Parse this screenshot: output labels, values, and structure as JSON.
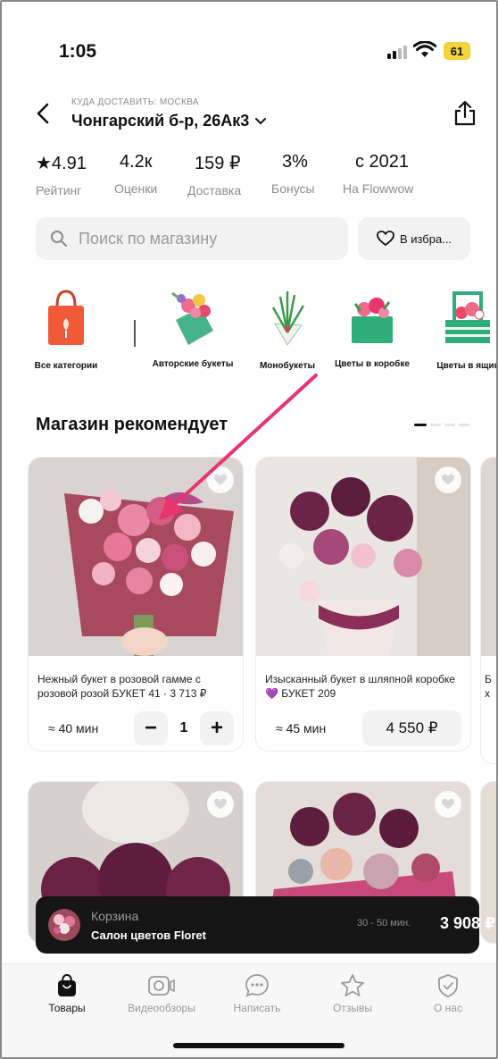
{
  "status_bar": {
    "time": "1:05",
    "battery": "61"
  },
  "header": {
    "delivery_caption": "КУДА ДОСТАВИТЬ: МОСКВА",
    "address": "Чонгарский б-р, 26Ак3"
  },
  "stats": [
    {
      "value": "★4.91",
      "label": "Рейтинг"
    },
    {
      "value": "4.2к",
      "label": "Оценки"
    },
    {
      "value": "159 ₽",
      "label": "Доставка"
    },
    {
      "value": "3%",
      "label": "Бонусы"
    },
    {
      "value": "с 2021",
      "label": "На Flowwow"
    }
  ],
  "search": {
    "placeholder": "Поиск по магазину"
  },
  "favorites": {
    "label": "В избра..."
  },
  "categories": [
    {
      "label": "Все категории"
    },
    {
      "label": "Авторские букеты"
    },
    {
      "label": "Монобукеты"
    },
    {
      "label": "Цветы в коробке"
    },
    {
      "label": "Цветы в ящик"
    }
  ],
  "section": {
    "title": "Магазин рекомендует"
  },
  "products": [
    {
      "title": "Нежный букет в розовой гамме с розовой розой БУКЕТ 41 · 3 713 ₽",
      "eta": "≈ 40 мин",
      "quantity": "1",
      "minus": "−",
      "plus": "+"
    },
    {
      "title": "Изысканный букет в шляпной коробке💜 БУКЕТ 209",
      "eta": "≈ 45 мин",
      "price": "4 550 ₽"
    }
  ],
  "peek_text": {
    "line1": "Б",
    "line2": "х"
  },
  "cart": {
    "label": "Корзина",
    "shop": "Салон цветов Floret",
    "time": "30 - 50 мин.",
    "price": "3 908 ₽"
  },
  "tabs": [
    {
      "label": "Товары",
      "icon": "bag-icon"
    },
    {
      "label": "Видеообзоры",
      "icon": "video-icon"
    },
    {
      "label": "Написать",
      "icon": "chat-icon"
    },
    {
      "label": "Отзывы",
      "icon": "star-icon"
    },
    {
      "label": "О нас",
      "icon": "shield-icon"
    }
  ],
  "colors": {
    "accent": "#e8356d",
    "battery": "#f5d33a",
    "cart_bg": "#151515"
  }
}
